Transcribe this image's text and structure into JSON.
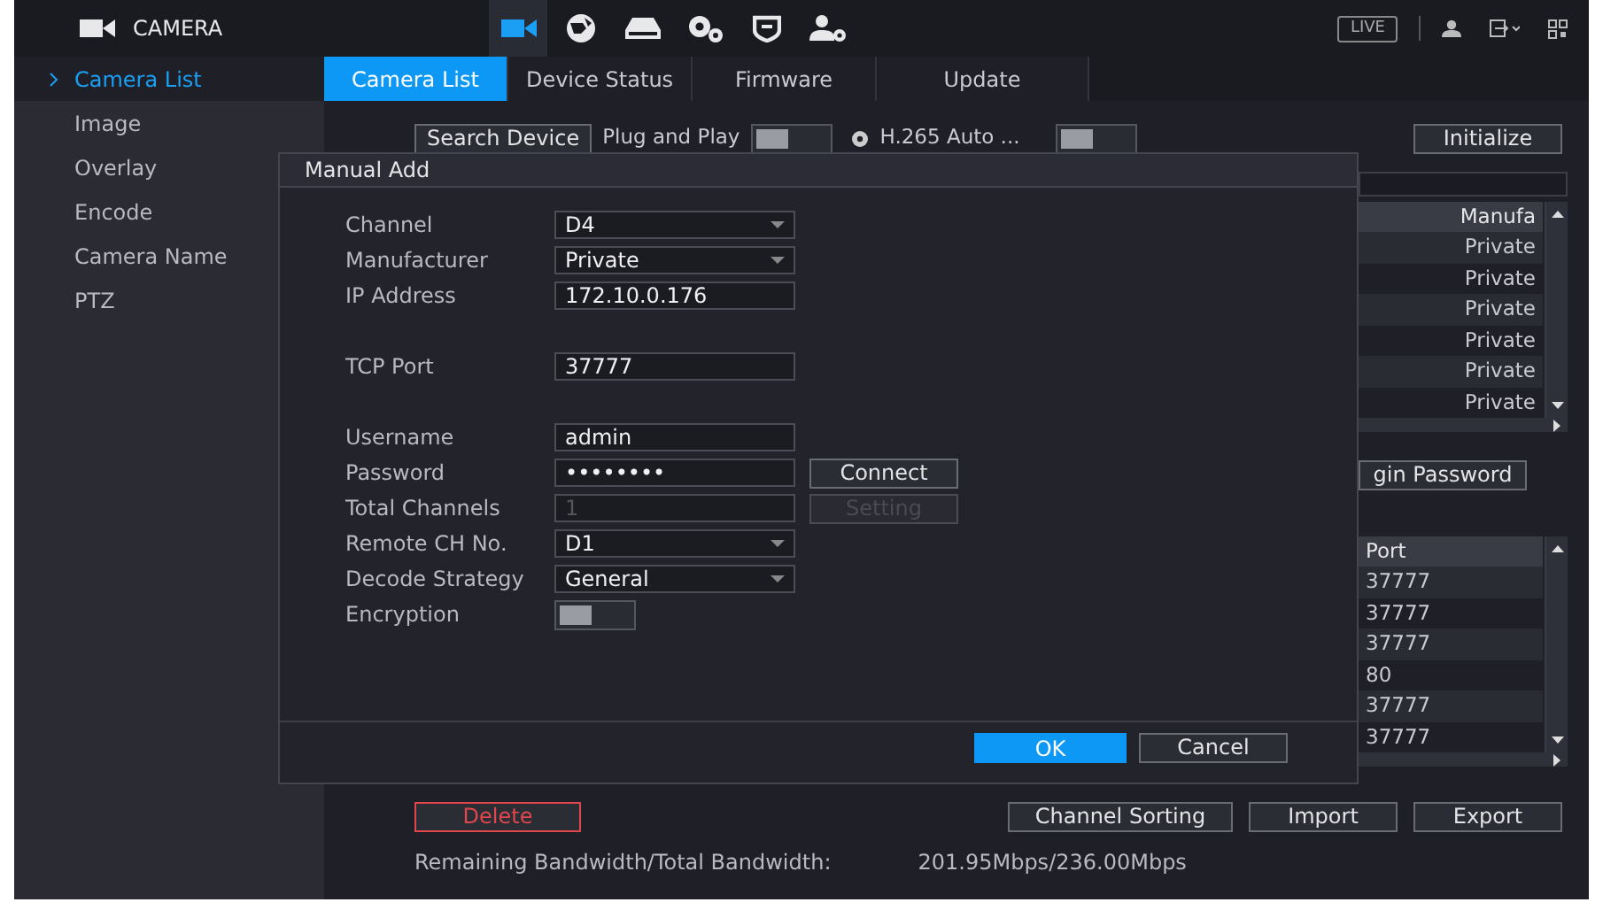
{
  "header": {
    "title": "CAMERA",
    "live": "LIVE",
    "nav_icons": [
      {
        "kind": "camera",
        "selected": true
      },
      {
        "kind": "network",
        "selected": false
      },
      {
        "kind": "storage",
        "selected": false
      },
      {
        "kind": "system",
        "selected": false
      },
      {
        "kind": "security",
        "selected": false
      },
      {
        "kind": "account",
        "selected": false
      }
    ]
  },
  "sidebar": {
    "items": [
      {
        "label": "Camera List",
        "selected": true
      },
      {
        "label": "Image",
        "selected": false
      },
      {
        "label": "Overlay",
        "selected": false
      },
      {
        "label": "Encode",
        "selected": false
      },
      {
        "label": "Camera Name",
        "selected": false
      },
      {
        "label": "PTZ",
        "selected": false
      }
    ]
  },
  "tabs": [
    {
      "label": "Camera List",
      "selected": true
    },
    {
      "label": "Device Status",
      "selected": false
    },
    {
      "label": "Firmware",
      "selected": false
    },
    {
      "label": "Update",
      "selected": false
    }
  ],
  "toolbar": {
    "search_button": "Search Device",
    "plug_and_play": {
      "label": "Plug and Play",
      "on": false
    },
    "h265": {
      "label": "H.265 Auto ...",
      "on": false
    },
    "initialize_button": "Initialize"
  },
  "device_table": {
    "columns": [
      "Manufa"
    ],
    "rows": [
      [
        "Private"
      ],
      [
        "Private"
      ],
      [
        "Private"
      ],
      [
        "Private"
      ],
      [
        "Private"
      ],
      [
        "Private"
      ]
    ]
  },
  "login_password_button": "gin Password",
  "added_table": {
    "columns": [
      "Port"
    ],
    "rows": [
      [
        "37777"
      ],
      [
        "37777"
      ],
      [
        "37777"
      ],
      [
        "80"
      ],
      [
        "37777"
      ],
      [
        "37777"
      ]
    ]
  },
  "actions": {
    "delete_button": "Delete",
    "buttons": [
      "Channel Sorting",
      "Import",
      "Export"
    ]
  },
  "bandwidth": {
    "label": "Remaining Bandwidth/Total Bandwidth:",
    "value": "201.95Mbps/236.00Mbps"
  },
  "dialog": {
    "title": "Manual Add",
    "groups": [
      [
        {
          "kind": "select",
          "label": "Channel",
          "value": "D4"
        },
        {
          "kind": "select",
          "label": "Manufacturer",
          "value": "Private"
        },
        {
          "kind": "text",
          "label": "IP Address",
          "value": "172.10.0.176"
        }
      ],
      [
        {
          "kind": "text",
          "label": "TCP Port",
          "value": "37777"
        }
      ],
      [
        {
          "kind": "text",
          "label": "Username",
          "value": "admin"
        },
        {
          "kind": "password",
          "label": "Password",
          "value": "••••••••",
          "button": {
            "label": "Connect",
            "disabled": false
          }
        },
        {
          "kind": "text",
          "label": "Total Channels",
          "value": "1",
          "disabled": true,
          "button": {
            "label": "Setting",
            "disabled": true
          }
        },
        {
          "kind": "select",
          "label": "Remote CH No.",
          "value": "D1"
        },
        {
          "kind": "select",
          "label": "Decode Strategy",
          "value": "General"
        },
        {
          "kind": "toggle",
          "label": "Encryption",
          "on": false
        }
      ]
    ],
    "buttons": [
      {
        "label": "OK",
        "primary": true
      },
      {
        "label": "Cancel",
        "primary": false
      }
    ]
  }
}
